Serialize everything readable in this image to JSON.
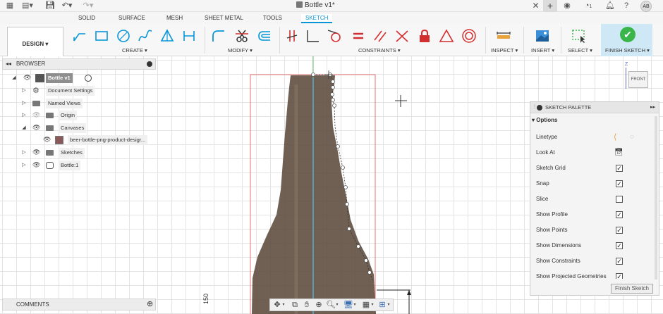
{
  "titlebar": {
    "doc_title": "Bottle v1*",
    "notifications_count": "1",
    "user_initials": "AB",
    "icons": [
      "grid-menu-icon",
      "file-menu-icon",
      "save-icon",
      "undo-icon",
      "redo-icon",
      "close-tab-icon",
      "new-tab-icon",
      "extensions-icon",
      "job-status-icon",
      "notifications-icon",
      "help-icon"
    ]
  },
  "workspace_tabs": [
    "SOLID",
    "SURFACE",
    "MESH",
    "SHEET METAL",
    "TOOLS",
    "SKETCH"
  ],
  "active_tab": "SKETCH",
  "ribbon": {
    "design_label": "DESIGN ▾",
    "groups": {
      "create": "CREATE ▾",
      "modify": "MODIFY ▾",
      "constraints": "CONSTRAINTS ▾",
      "inspect": "INSPECT ▾",
      "insert": "INSERT ▾",
      "select": "SELECT ▾",
      "finish": "FINISH SKETCH ▾"
    },
    "accent": "#0696d7",
    "constraint_color": "#d32f2f"
  },
  "browser": {
    "title": "BROWSER",
    "root": "Bottle v1",
    "items": [
      "Document Settings",
      "Named Views",
      "Origin",
      "Canvases",
      "beer-bottle-png-product-desigr...",
      "Sketches",
      "Bottle:1"
    ]
  },
  "comments": {
    "title": "COMMENTS"
  },
  "viewcube": {
    "face": "FRONT",
    "axis": "Z"
  },
  "dimension_text": "150",
  "palette": {
    "title": "SKETCH PALETTE",
    "section": "Options",
    "rows": [
      {
        "label": "Linetype",
        "control": "icons"
      },
      {
        "label": "Look At",
        "control": "icon"
      },
      {
        "label": "Sketch Grid",
        "checked": true
      },
      {
        "label": "Snap",
        "checked": true
      },
      {
        "label": "Slice",
        "checked": false
      },
      {
        "label": "Show Profile",
        "checked": true
      },
      {
        "label": "Show Points",
        "checked": true
      },
      {
        "label": "Show Dimensions",
        "checked": true
      },
      {
        "label": "Show Constraints",
        "checked": true
      },
      {
        "label": "Show Projected Geometries",
        "checked": true
      }
    ],
    "finish_button": "Finish Sketch"
  }
}
